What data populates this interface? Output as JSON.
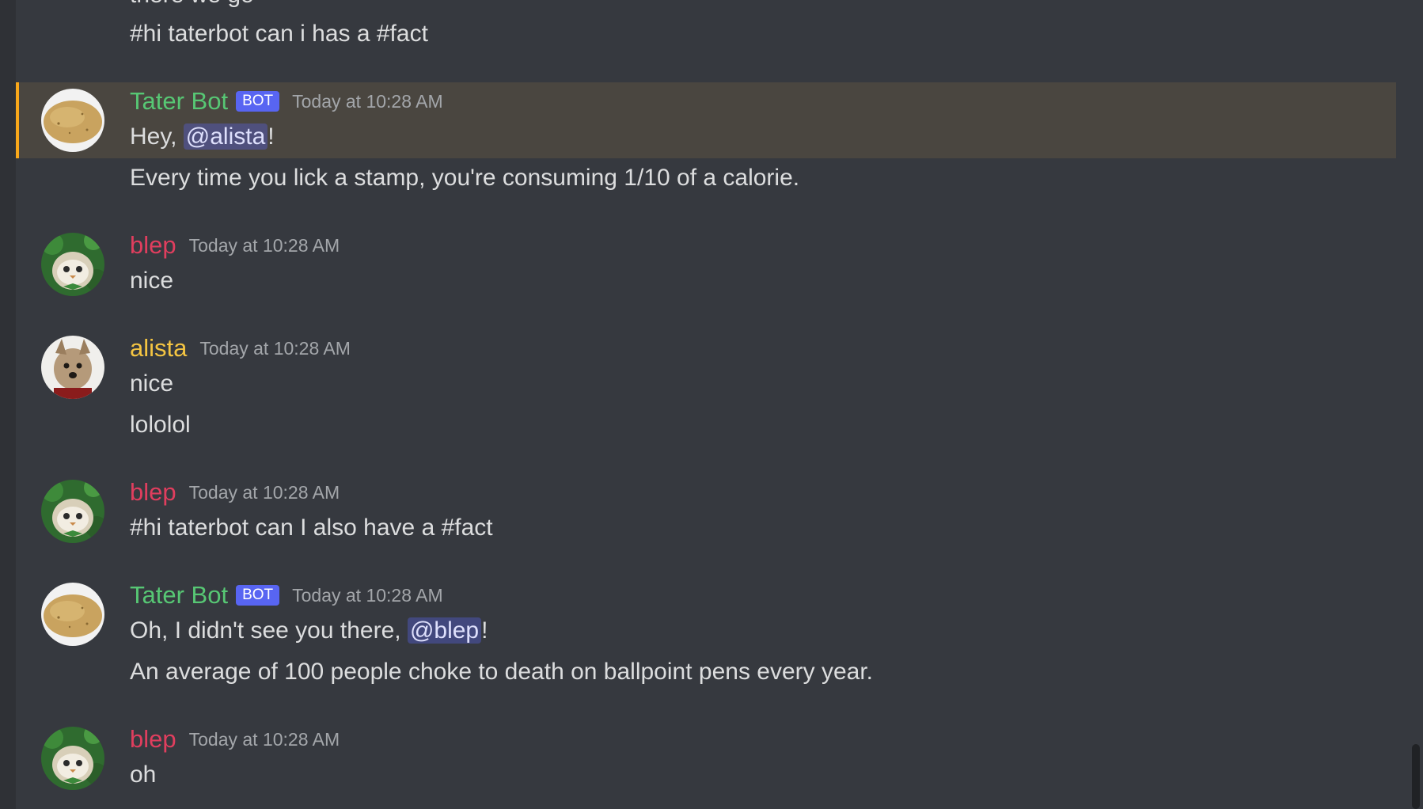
{
  "colors": {
    "bot_name": "#57c774",
    "blep_name": "#e03e5e",
    "alista_name": "#f5c542",
    "highlight_border": "#faa81a",
    "background": "#36393f"
  },
  "top_messages": {
    "partial_line": "there we go",
    "line": "#hi taterbot can i has a #fact"
  },
  "groups": [
    {
      "username": "Tater Bot",
      "bot_tag": "BOT",
      "timestamp": "Today at 10:28 AM",
      "avatar": "potato-avatar",
      "line1_prefix": "Hey, ",
      "line1_mention": "@alista",
      "line1_suffix": "!",
      "line2": "Every time you lick a stamp, you're consuming 1/10 of a calorie."
    },
    {
      "username": "blep",
      "timestamp": "Today at 10:28 AM",
      "avatar": "owl-avatar",
      "line1": "nice"
    },
    {
      "username": "alista",
      "timestamp": "Today at 10:28 AM",
      "avatar": "dog-avatar",
      "line1": "nice",
      "line2": "lololol"
    },
    {
      "username": "blep",
      "timestamp": "Today at 10:28 AM",
      "avatar": "owl-avatar",
      "line1": "#hi taterbot can I also have a #fact"
    },
    {
      "username": "Tater Bot",
      "bot_tag": "BOT",
      "timestamp": "Today at 10:28 AM",
      "avatar": "potato-avatar",
      "line1_prefix": "Oh, I didn't see you there, ",
      "line1_mention": "@blep",
      "line1_suffix": "!",
      "line2": "An average of 100 people choke to death on ballpoint pens every year."
    },
    {
      "username": "blep",
      "timestamp": "Today at 10:28 AM",
      "avatar": "owl-avatar",
      "line1": "oh"
    }
  ]
}
